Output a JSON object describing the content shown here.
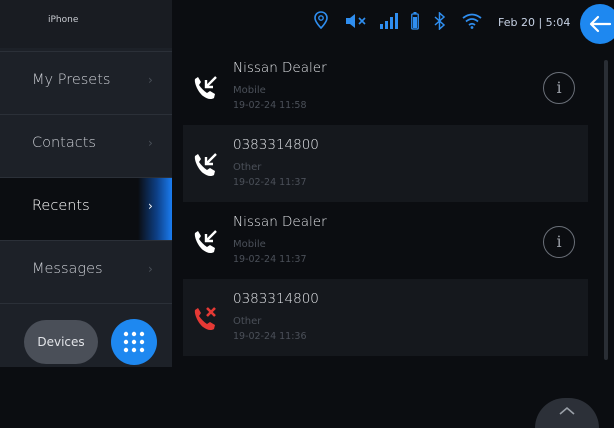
{
  "sidebar": {
    "device_name": "iPhone",
    "items": [
      {
        "label": "My Presets"
      },
      {
        "label": "Contacts"
      },
      {
        "label": "Recents"
      },
      {
        "label": "Messages"
      }
    ],
    "devices_label": "Devices"
  },
  "status": {
    "date": "Feb 20",
    "time": "5:04",
    "clock": "Feb 20 | 5:04",
    "icons": [
      "location-pin-icon",
      "mute-icon",
      "signal-bars-icon",
      "battery-icon",
      "bluetooth-icon",
      "wifi-icon"
    ],
    "accent_color": "#1e88f0"
  },
  "calls": [
    {
      "name": "Nissan Dealer",
      "type": "Mobile",
      "datetime": "19-02-24 11:58",
      "direction": "incoming",
      "has_info": true
    },
    {
      "name": "0383314800",
      "type": "Other",
      "datetime": "19-02-24 11:37",
      "direction": "incoming",
      "has_info": false
    },
    {
      "name": "Nissan Dealer",
      "type": "Mobile",
      "datetime": "19-02-24 11:37",
      "direction": "incoming",
      "has_info": true
    },
    {
      "name": "0383314800",
      "type": "Other",
      "datetime": "19-02-24 11:36",
      "direction": "missed",
      "has_info": false
    }
  ],
  "colors": {
    "incoming": "#ffffff",
    "missed": "#e53935"
  }
}
